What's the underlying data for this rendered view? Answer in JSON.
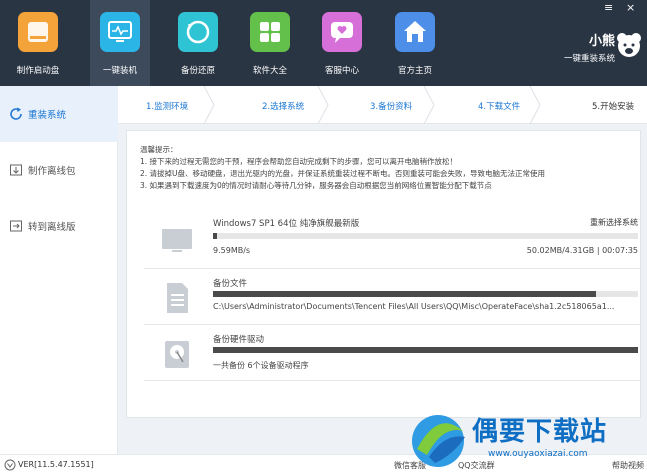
{
  "window": {
    "menu_icon": "≡",
    "close_icon": "×"
  },
  "tabs": [
    {
      "label": "制作启动盘",
      "color": "#f4a33b",
      "icon": "disk-icon"
    },
    {
      "label": "一键装机",
      "color": "#2bb5e6",
      "icon": "monitor-pulse-icon"
    },
    {
      "label": "备份还原",
      "color": "#2ec4d4",
      "icon": "restore-icon"
    },
    {
      "label": "软件大全",
      "color": "#63c04a",
      "icon": "grid-icon"
    },
    {
      "label": "客服中心",
      "color": "#d76fd8",
      "icon": "chat-heart-icon"
    },
    {
      "label": "官方主页",
      "color": "#4c8ee8",
      "icon": "home-icon"
    }
  ],
  "brand": {
    "name": "小熊",
    "tagline": "一键重装系统"
  },
  "sidebar": [
    {
      "label": "重装系统",
      "icon": "refresh-icon"
    },
    {
      "label": "制作离线包",
      "icon": "package-icon"
    },
    {
      "label": "转到离线版",
      "icon": "switch-icon"
    }
  ],
  "steps": [
    "1.监测环境",
    "2.选择系统",
    "3.备份资料",
    "4.下载文件",
    "5.开始安装"
  ],
  "tips": [
    "温馨提示：",
    "1. 接下来的过程无需您的干预，程序会帮助您自动完成剩下的步骤，您可以离开电脑稍作放松！",
    "2. 请拔掉U盘、移动硬盘，退出光驱内的光盘，并保证系统重装过程不断电。否则重装可能会失败，导致电脑无法正常使用",
    "3. 如果遇到下载速度为0的情况时请耐心等待几分钟，服务器会自动根据您当前网络位置智能分配下载节点"
  ],
  "download": {
    "title": "Windows7 SP1 64位 纯净旗舰最新版",
    "reselect": "重新选择系统",
    "speed": "9.59MB/s",
    "stats": "50.02MB/4.31GB | 00:07:35",
    "progress": 0.01
  },
  "backup": {
    "title": "备份文件",
    "path": "C:\\Users\\Administrator\\Documents\\Tencent Files\\All Users\\QQ\\Misc\\OperateFace\\sha1.2c518065a1...",
    "progress": 0.9
  },
  "driver": {
    "title": "备份硬件驱动",
    "status": "一共备份 6个设备驱动程序",
    "progress": 1.0
  },
  "footer": {
    "version": "VER[11.5.47.1551]",
    "wechat": "微信客服",
    "qq": "QQ交流群",
    "help": "帮助视频"
  },
  "watermark": {
    "name": "偶要下载站",
    "url": "www.ouyaoxiazai.com"
  }
}
